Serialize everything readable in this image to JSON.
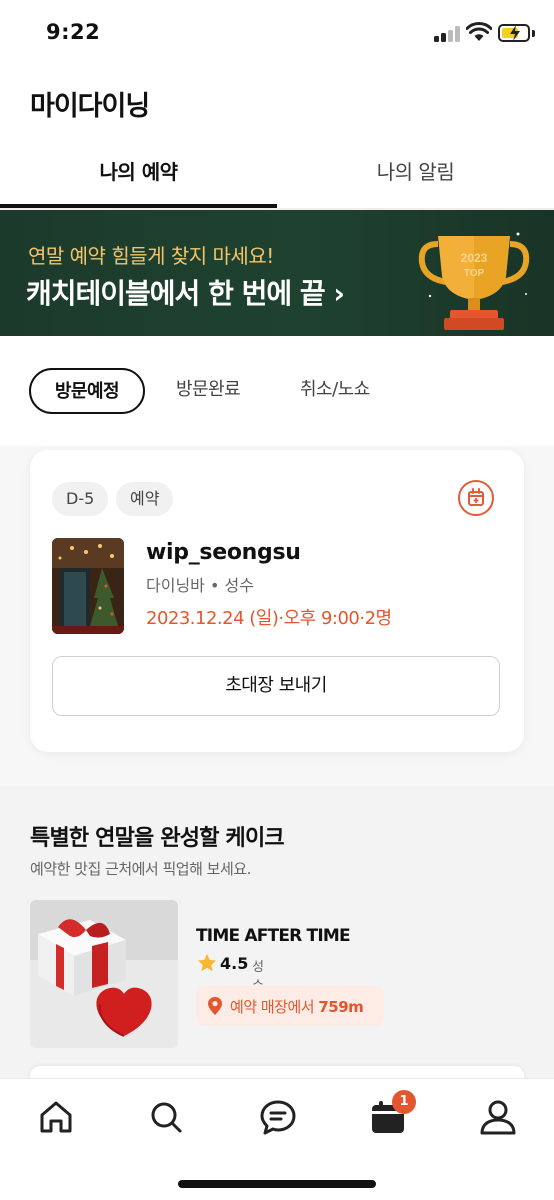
{
  "status_bar": {
    "time": "9:22"
  },
  "header": {
    "title": "마이다이닝"
  },
  "tabs": [
    {
      "label": "나의 예약",
      "active": true
    },
    {
      "label": "나의 알림",
      "active": false
    }
  ],
  "banner": {
    "subtitle": "연말 예약 힘들게 찾지 마세요!",
    "title": "캐치테이블에서 한 번에 끝 ›",
    "trophy_year": "2023",
    "trophy_text": "TOP"
  },
  "filters": [
    {
      "label": "방문예정",
      "active": true
    },
    {
      "label": "방문완료",
      "active": false
    },
    {
      "label": "취소/노쇼",
      "active": false
    }
  ],
  "reservation": {
    "dday": "D-5",
    "status": "예약",
    "name": "wip_seongsu",
    "meta": "다이닝바 • 성수",
    "datetime": "2023.12.24 (일)·오후 9:00·2명",
    "invite_button": "초대장 보내기"
  },
  "cake_section": {
    "title": "특별한 연말을 완성할 케이크",
    "subtitle": "예약한 맛집 근처에서 픽업해 보세요.",
    "item": {
      "name": "TIME AFTER TIME",
      "rating": "4.5",
      "area": "성수",
      "distance_label": "예약 매장에서",
      "distance_value": "759m"
    }
  },
  "bottom_nav": {
    "items": [
      "home-icon",
      "search-icon",
      "chat-icon",
      "calendar-icon",
      "profile-icon"
    ],
    "badge_count": "1"
  },
  "colors": {
    "accent": "#e4572e",
    "banner_bg": "#1f4230",
    "banner_sub": "#f3c46a",
    "battery": "#f5d21a"
  }
}
